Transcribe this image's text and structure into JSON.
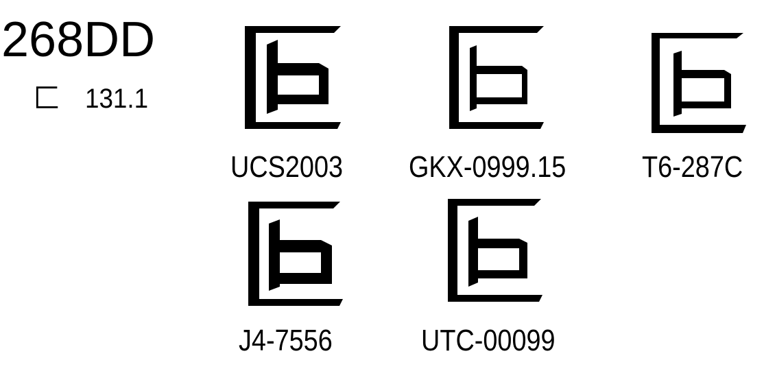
{
  "codepoint": "268DD",
  "radical": {
    "glyph": "匚",
    "index": "131.1"
  },
  "variants": [
    {
      "glyph_icon": "ideograph-268DD-glyph",
      "source": "UCS2003"
    },
    {
      "glyph_icon": "ideograph-268DD-glyph",
      "source": "GKX-0999.15"
    },
    {
      "glyph_icon": "ideograph-268DD-glyph",
      "source": "T6-287C"
    },
    {
      "glyph_icon": "ideograph-268DD-glyph",
      "source": "J4-7556"
    },
    {
      "glyph_icon": "ideograph-268DD-glyph",
      "source": "UTC-00099"
    }
  ]
}
